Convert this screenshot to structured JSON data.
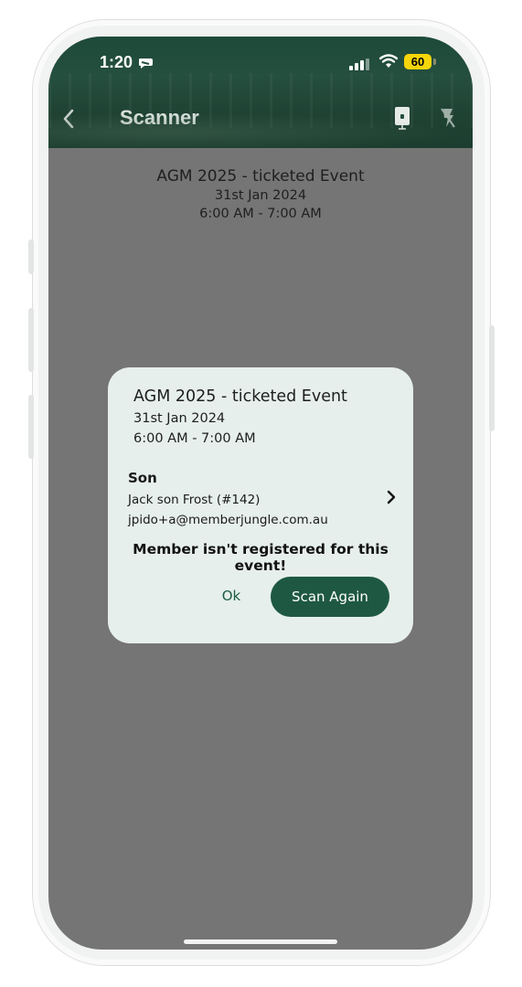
{
  "status_bar": {
    "time": "1:20",
    "battery": "60"
  },
  "header": {
    "title": "Scanner"
  },
  "event": {
    "title": "AGM 2025 - ticketed Event",
    "date": "31st Jan 2024",
    "time": "6:00 AM - 7:00 AM"
  },
  "dialog": {
    "event_title": "AGM 2025 - ticketed Event",
    "event_date": "31st Jan 2024",
    "event_time": "6:00 AM - 7:00 AM",
    "member": {
      "relation": "Son",
      "name": "Jack son Frost (#142)",
      "email": "jpido+a@memberjungle.com.au"
    },
    "warning": "Member isn't registered for this event!",
    "ok_label": "Ok",
    "scan_again_label": "Scan Again"
  },
  "colors": {
    "header_green": "#1f4a3a",
    "accent_green": "#1e5843",
    "dialog_bg": "#e6efeb",
    "overlay_grey": "#757575",
    "battery_yellow": "#f5d60a"
  },
  "icons": [
    "chat-bubble-icon",
    "signal-icon",
    "wifi-icon",
    "back-chevron-icon",
    "device-icon",
    "flash-off-icon",
    "chevron-right-icon"
  ]
}
